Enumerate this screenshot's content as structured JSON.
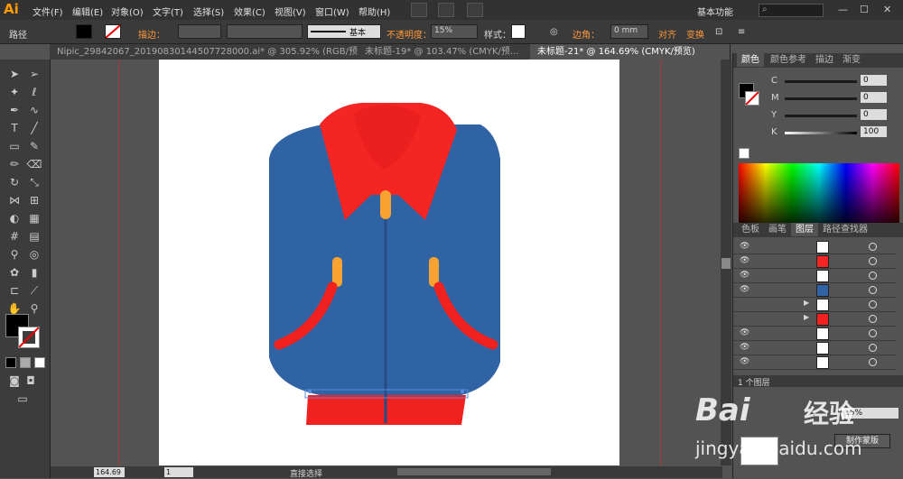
{
  "app": {
    "logo": "Ai"
  },
  "menu": [
    "文件(F)",
    "编辑(E)",
    "对象(O)",
    "文字(T)",
    "选择(S)",
    "效果(C)",
    "视图(V)",
    "窗口(W)",
    "帮助(H)"
  ],
  "workspace": "基本功能",
  "control": {
    "path_label": "路径",
    "stroke_label": "描边：",
    "brush_label": "基本",
    "opacity_label": "不透明度：",
    "opacity_value": "15%",
    "style_label": "样式：",
    "corner_label": "边角：",
    "corner_value": "0 mm",
    "align_label": "对齐",
    "transform_label": "变换"
  },
  "tabs": [
    {
      "label": "Nipic_29842067_20190830144507728000.ai* @ 305.92% (RGB/预..."
    },
    {
      "label": "未标题-19* @ 103.47% (CMYK/预..."
    },
    {
      "label": "未标题-21* @ 164.69% (CMYK/预览)"
    }
  ],
  "panels": {
    "color_tabs": [
      "颜色",
      "颜色参考",
      "描边",
      "渐变"
    ],
    "cmyk": [
      {
        "label": "C",
        "value": "0"
      },
      {
        "label": "M",
        "value": "0"
      },
      {
        "label": "Y",
        "value": "0"
      },
      {
        "label": "K",
        "value": "100"
      }
    ],
    "layer_tabs": [
      "色板",
      "画笔",
      "图层",
      "路径查找器"
    ],
    "layer_count": "1 个图层",
    "make_mask": "制作蒙版",
    "opacity_value": "15%"
  },
  "status": {
    "zoom": "164.69",
    "page": "1",
    "tool": "直接选择"
  },
  "watermark": {
    "brand": "Bai",
    "brand2": "经验",
    "url": "jingyan.baidu.com"
  },
  "colors": {
    "jacket_blue": "#2f63a3",
    "collar_red": "#f52523",
    "accent_orange": "#f7a231",
    "stripe_red": "#f0211f"
  }
}
